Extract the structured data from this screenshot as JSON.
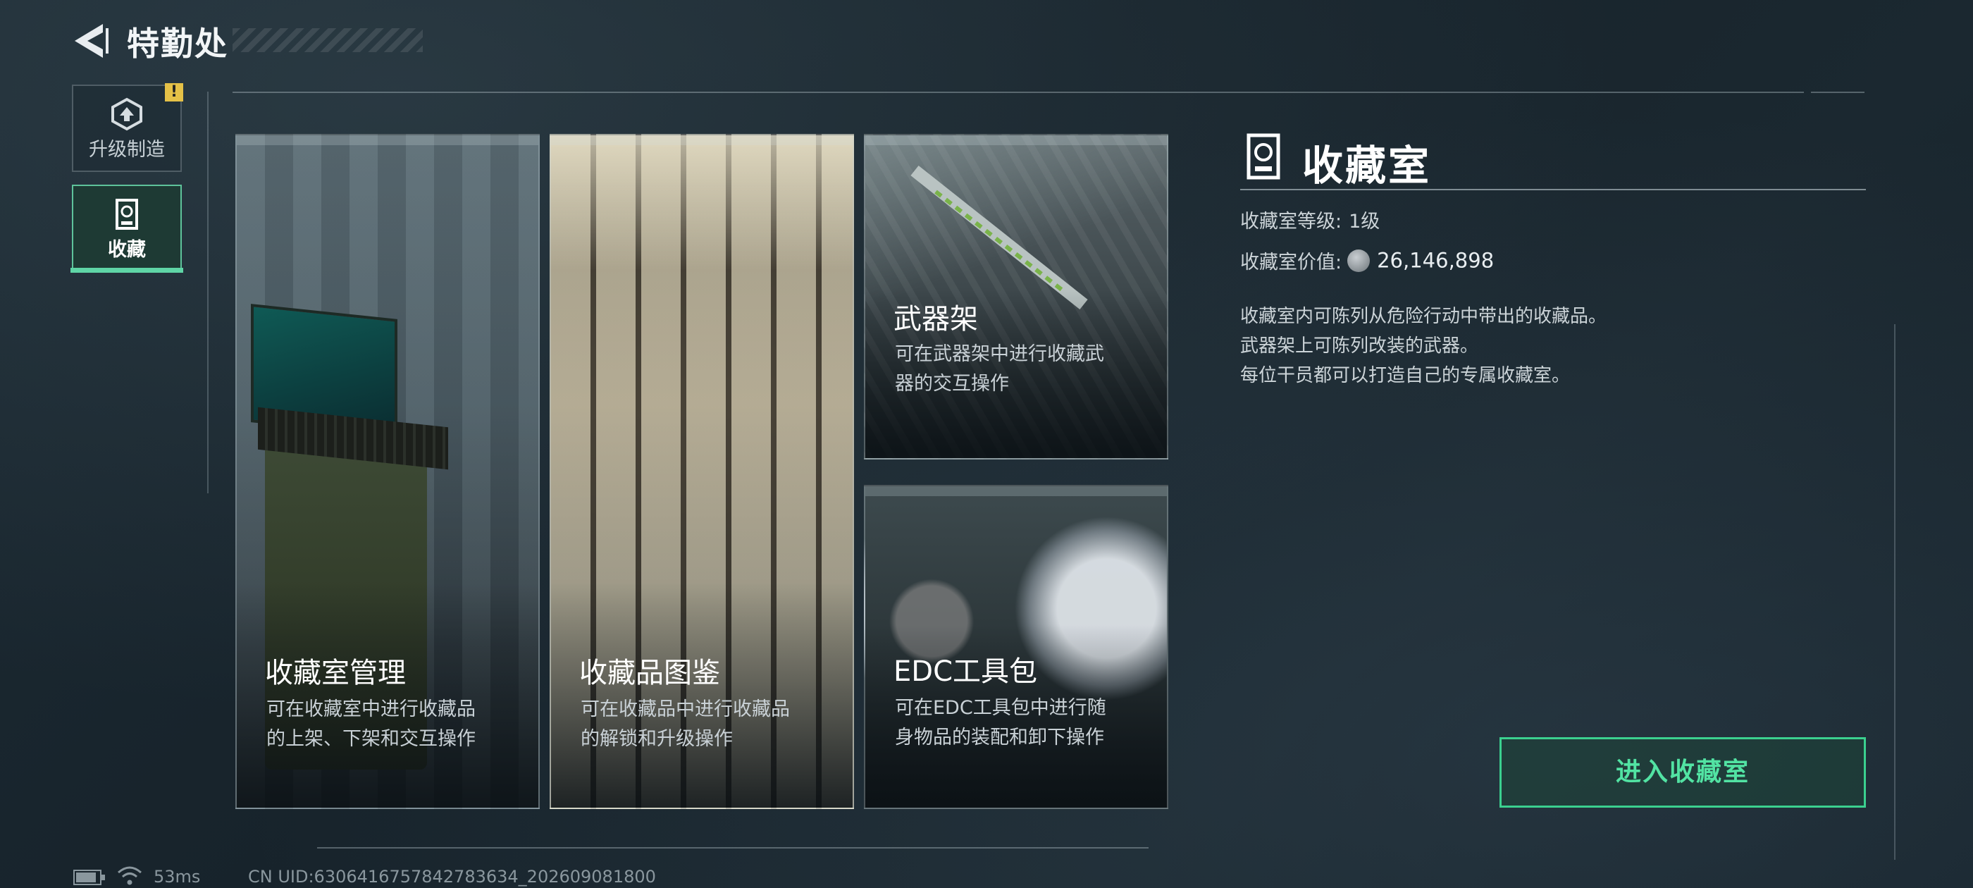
{
  "header": {
    "title": "特勤处"
  },
  "sidebar": {
    "items": [
      {
        "label": "升级制造",
        "icon": "upgrade-icon",
        "alert": "!"
      },
      {
        "label": "收藏",
        "icon": "collection-icon",
        "selected": true
      }
    ]
  },
  "cards": [
    {
      "title": "收藏室管理",
      "desc_lines": [
        "可在收藏室中进行收藏品",
        "的上架、下架和交互操作"
      ]
    },
    {
      "title": "收藏品图鉴",
      "desc_lines": [
        "可在收藏品中进行收藏品",
        "的解锁和升级操作"
      ]
    },
    {
      "title": "武器架",
      "desc_lines": [
        "可在武器架中进行收藏武",
        "器的交互操作"
      ]
    },
    {
      "title": "EDC工具包",
      "desc_lines": [
        "可在EDC工具包中进行随",
        "身物品的装配和卸下操作"
      ]
    }
  ],
  "info": {
    "title": "收藏室",
    "level_label": "收藏室等级:",
    "level_value": "1级",
    "value_label": "收藏室价值:",
    "value_amount": "26,146,898",
    "description": [
      "收藏室内可陈列从危险行动中带出的收藏品。",
      "武器架上可陈列改装的武器。",
      "每位干员都可以打造自己的专属收藏室。"
    ],
    "enter_button": "进入收藏室"
  },
  "status_bar": {
    "ping": "53ms",
    "uid": "CN UID:6306416757842783634_202609081800"
  },
  "colors": {
    "accent": "#3bd08f",
    "alert": "#e5c147",
    "background": "#1a2730"
  }
}
